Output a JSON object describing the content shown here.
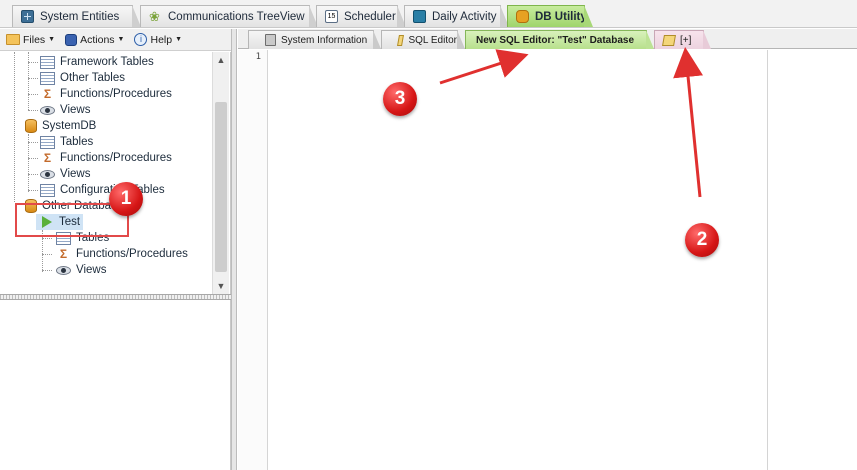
{
  "top_tabs": [
    {
      "label": "System Entities",
      "icon": "grid-icon"
    },
    {
      "label": "Communications TreeView",
      "icon": "leaf-icon"
    },
    {
      "label": "Scheduler",
      "icon": "calendar-icon",
      "icon_text": "15"
    },
    {
      "label": "Daily Activity",
      "icon": "daily-grid-icon"
    },
    {
      "label": "DB Utility",
      "icon": "database-icon",
      "active": true
    }
  ],
  "left_toolbar": {
    "files": "Files",
    "actions": "Actions",
    "help": "Help"
  },
  "tree": {
    "items": [
      {
        "label": "Framework Tables",
        "icon": "table-icon"
      },
      {
        "label": "Other Tables",
        "icon": "table-icon"
      },
      {
        "label": "Functions/Procedures",
        "icon": "sigma-icon"
      },
      {
        "label": "Views",
        "icon": "eye-icon"
      },
      {
        "label": "SystemDB",
        "icon": "database-icon"
      },
      {
        "label": "Tables",
        "icon": "table-icon"
      },
      {
        "label": "Functions/Procedures",
        "icon": "sigma-icon"
      },
      {
        "label": "Views",
        "icon": "eye-icon"
      },
      {
        "label": "Configuration Tables",
        "icon": "table-icon"
      },
      {
        "label": "Other Databases",
        "icon": "database-icon"
      },
      {
        "label": "Test",
        "icon": "play-icon",
        "selected": true
      },
      {
        "label": "Tables",
        "icon": "table-icon"
      },
      {
        "label": "Functions/Procedures",
        "icon": "sigma-icon"
      },
      {
        "label": "Views",
        "icon": "eye-icon"
      }
    ]
  },
  "editor_tabs": [
    {
      "label": "System Information",
      "icon": "system-info-icon"
    },
    {
      "label": "SQL Editor",
      "icon": "sql-editor-icon"
    },
    {
      "label": "New SQL Editor: \"Test\" Database",
      "active": true
    },
    {
      "label": "[+]",
      "icon": "sql-editor-icon"
    }
  ],
  "editor": {
    "line_numbers": [
      "1"
    ],
    "content": ""
  },
  "annotations": {
    "badges": [
      "1",
      "2",
      "3"
    ],
    "color": "#d61616"
  },
  "colors": {
    "active_tab": "#9fd46c",
    "selection": "#cfe3f5",
    "annotation_red": "#e24a4a"
  }
}
